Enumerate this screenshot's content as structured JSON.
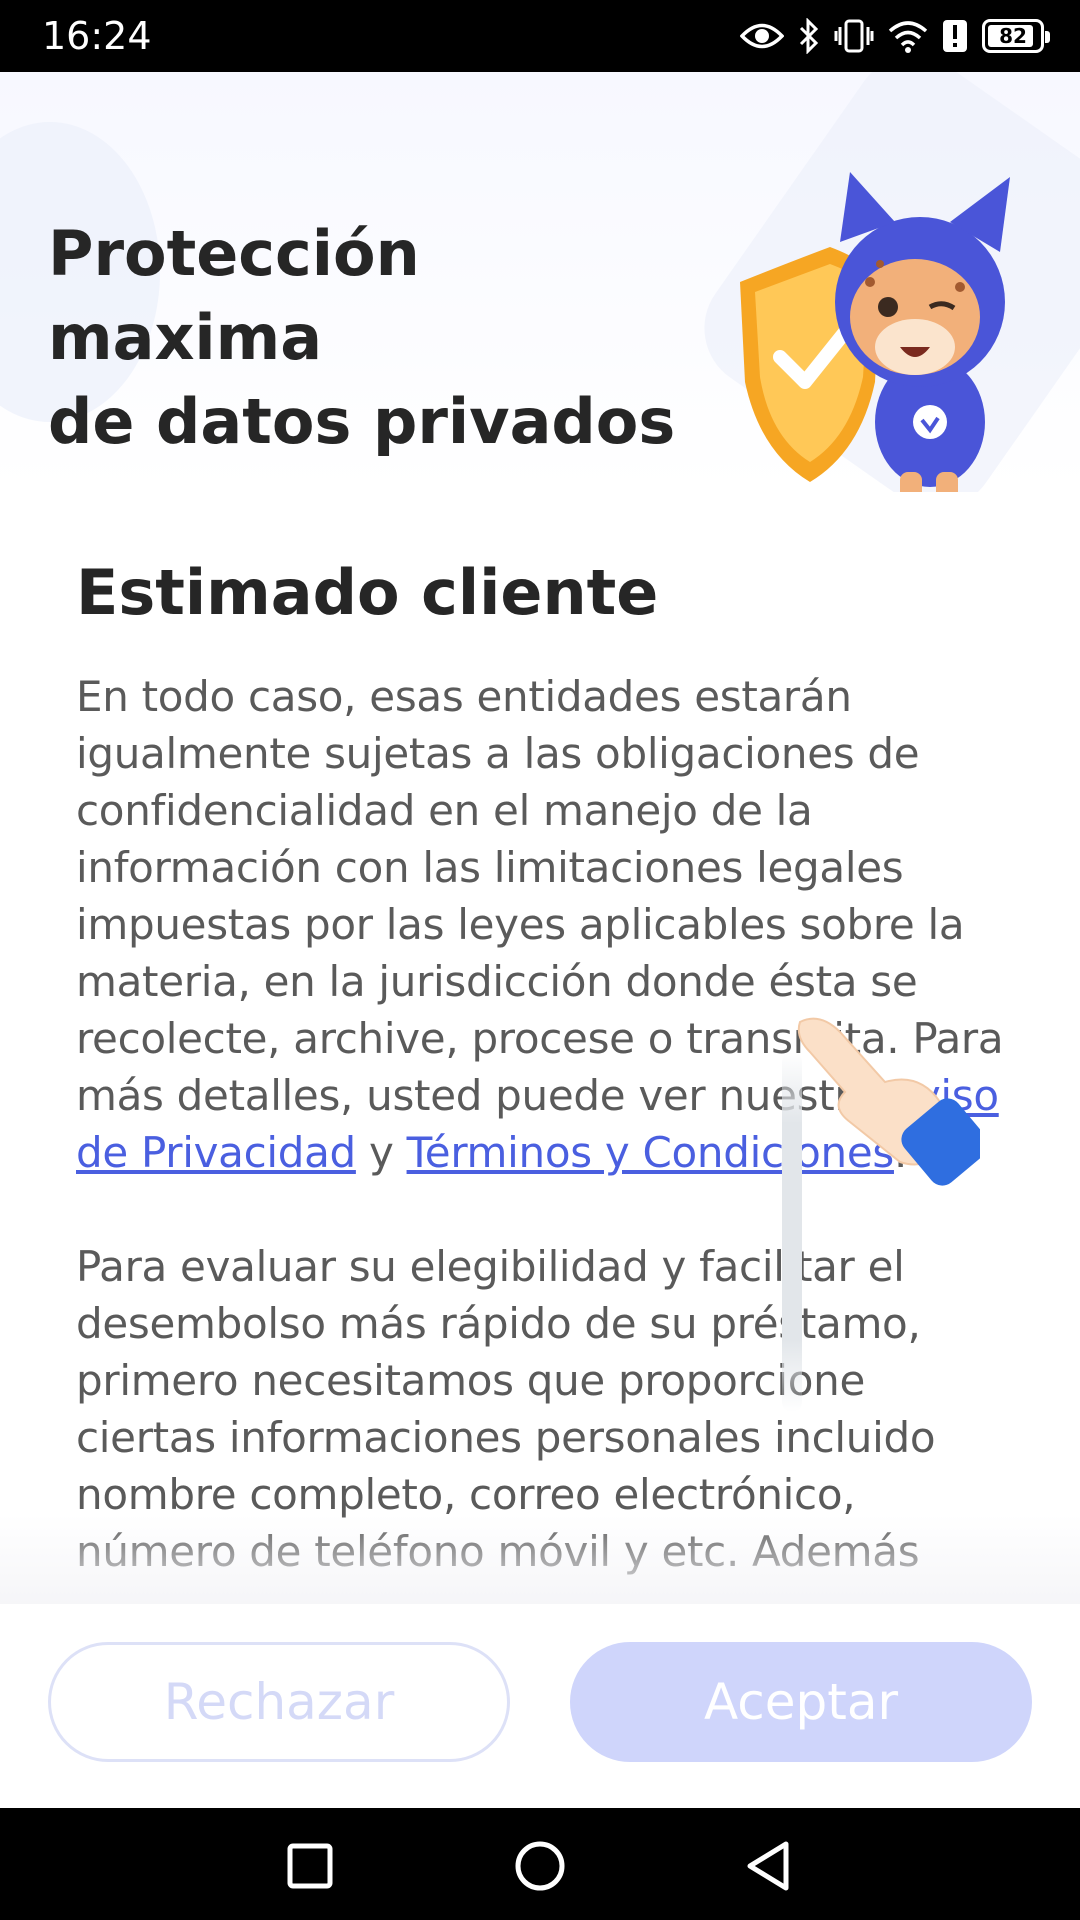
{
  "status_bar": {
    "time": "16:24",
    "battery": "82",
    "icons": [
      "eye-icon",
      "bluetooth-icon",
      "vibrate-icon",
      "wifi-icon",
      "alert-icon",
      "battery-icon"
    ]
  },
  "hero": {
    "title_line1": "Protección maxima",
    "title_line2": "de datos privados",
    "illustration": "mascot-shield-illustration"
  },
  "content": {
    "heading": "Estimado cliente",
    "paragraph1_text": "En todo caso, esas entidades estarán igualmente sujetas a las obligaciones de confidencialidad en el manejo de la información con las limitaciones legales impuestas por las leyes aplicables sobre la materia, en la jurisdicción donde ésta se recolecte, archive, procese o transmita. Para más detalles, usted puede ver nuestra ",
    "link_privacy": "Aviso de Privacidad",
    "connector": " y ",
    "link_terms": "Términos y Condiciones",
    "paragraph1_end": ".",
    "paragraph2": "Para evaluar su elegibilidad y facilitar el desembolso más rápido de su préstamo, primero necesitamos que proporcione ciertas informaciones personales incluido nombre completo, correo electrónico, número de teléfono móvil y etc. Además"
  },
  "actions": {
    "reject_label": "Rechazar",
    "accept_label": "Aceptar"
  },
  "colors": {
    "link": "#4a5fe0",
    "accept_bg": "#cfd5fb",
    "reject_border": "#dde1f7",
    "title": "#262626",
    "body": "#5a5a5a"
  },
  "nav_bar": {
    "buttons": [
      "recent-apps-icon",
      "home-icon",
      "back-icon"
    ]
  }
}
